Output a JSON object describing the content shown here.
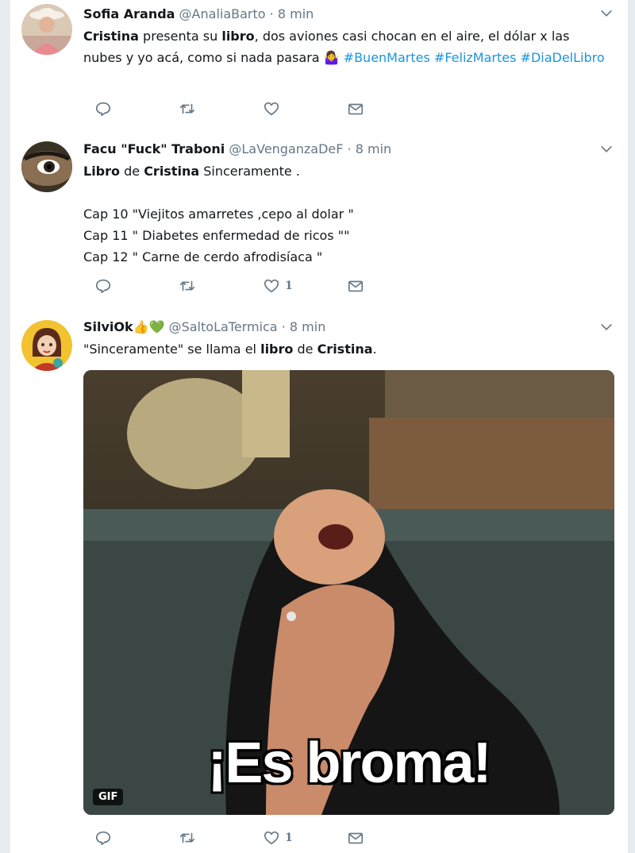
{
  "tweets": [
    {
      "name": "Sofia Aranda",
      "handle": "@AnaliaBarto",
      "dot": "·",
      "time": "8 min",
      "body": {
        "w1": "Cristina",
        "t1": " presenta su ",
        "w2": "libro",
        "t2": ", dos aviones casi chocan en el aire, el dólar x las nubes y yo acá, como si nada pasara ",
        "emoji": "🤷‍♀️",
        "h1": "#BuenMartes",
        "h2": "#FelizMartes",
        "h3": "#DiaDelLibro"
      },
      "likes": ""
    },
    {
      "name": "Facu \"Fuck\" Traboni",
      "handle": "@LaVenganzaDeF",
      "dot": "·",
      "time": "8 min",
      "body": {
        "w1": "Libro",
        "t1": " de ",
        "w2": "Cristina",
        "t2": " Sinceramente .",
        "line1": "Cap 10 \"Viejitos amarretes ,cepo al dolar \"",
        "line2": "Cap 11 \" Diabetes enfermedad de ricos \"\"",
        "line3": "Cap 12 \" Carne de cerdo afrodisíaca \""
      },
      "likes": "1"
    },
    {
      "name": "SilviOk",
      "emoji": "👍💚",
      "handle": "@SaltoLaTermica",
      "dot": "·",
      "time": "8 min",
      "body": {
        "t1": "\"Sinceramente\" se llama el ",
        "w1": "libro",
        "t2": " de ",
        "w2": "Cristina",
        "t3": "."
      },
      "media": {
        "caption": "¡Es broma!",
        "badge": "GIF"
      },
      "likes": "1"
    }
  ],
  "icons": [
    "reply-icon",
    "retweet-icon",
    "like-icon",
    "direct-message-icon",
    "chevron-down-icon"
  ],
  "colors": {
    "hashtag": "#1b95e0",
    "muted": "#657786",
    "text": "#14171a",
    "divider": "#e6ecf0"
  }
}
